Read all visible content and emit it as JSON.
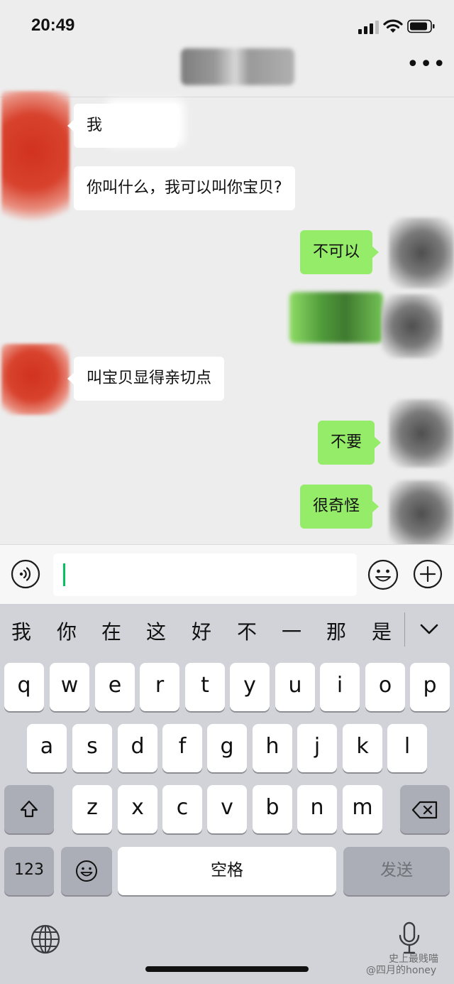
{
  "status_bar": {
    "time": "20:49"
  },
  "header": {
    "more_label": "•••"
  },
  "messages": [
    {
      "side": "in",
      "text": "我"
    },
    {
      "side": "in",
      "text": "你叫什么，我可以叫你宝贝?"
    },
    {
      "side": "out",
      "text": "不可以"
    },
    {
      "side": "out",
      "text": ""
    },
    {
      "side": "in",
      "text": "叫宝贝显得亲切点"
    },
    {
      "side": "out",
      "text": "不要"
    },
    {
      "side": "out",
      "text": "很奇怪"
    }
  ],
  "input": {
    "value": ""
  },
  "keyboard": {
    "candidates": [
      "我",
      "你",
      "在",
      "这",
      "好",
      "不",
      "一",
      "那",
      "是"
    ],
    "row1": [
      "q",
      "w",
      "e",
      "r",
      "t",
      "y",
      "u",
      "i",
      "o",
      "p"
    ],
    "row2": [
      "a",
      "s",
      "d",
      "f",
      "g",
      "h",
      "j",
      "k",
      "l"
    ],
    "row3": [
      "z",
      "x",
      "c",
      "v",
      "b",
      "n",
      "m"
    ],
    "numbers_label": "123",
    "space_label": "空格",
    "send_label": "发送"
  },
  "watermark": {
    "line1": "史上最贱喵",
    "line2": "@四月的honey"
  },
  "colors": {
    "bubble_out": "#95ec69",
    "bubble_in": "#ffffff",
    "caret": "#07c160",
    "background": "#ededed",
    "keyboard": "#d1d3d9"
  }
}
